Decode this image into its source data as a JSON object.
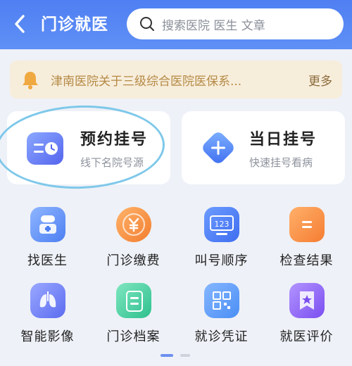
{
  "header": {
    "title": "门诊就医",
    "search_placeholder": "搜索医院 医生 文章"
  },
  "notice": {
    "text": "津南医院关于三级综合医院医保系...",
    "more": "更多"
  },
  "cards": [
    {
      "title": "预约挂号",
      "subtitle": "线下名院号源",
      "icon": "calendar-clock-icon"
    },
    {
      "title": "当日挂号",
      "subtitle": "快速挂号看病",
      "icon": "plus-diamond-icon"
    }
  ],
  "grid": [
    {
      "label": "找医生",
      "icon": "doctor-icon",
      "color": "#5b8df6"
    },
    {
      "label": "门诊缴费",
      "icon": "yuan-coin-icon",
      "color": "#f28a3c"
    },
    {
      "label": "叫号顺序",
      "icon": "queue-number-icon",
      "color": "#4d80f0"
    },
    {
      "label": "检查结果",
      "icon": "report-icon",
      "color": "#f5893c"
    },
    {
      "label": "智能影像",
      "icon": "lung-image-icon",
      "color": "#6c7cf2"
    },
    {
      "label": "门诊档案",
      "icon": "archive-icon",
      "color": "#3fcf9f"
    },
    {
      "label": "就诊凭证",
      "icon": "qr-code-icon",
      "color": "#4f9cf7"
    },
    {
      "label": "就医评价",
      "icon": "star-badge-icon",
      "color": "#8b5cf2"
    }
  ],
  "colors": {
    "header": "#5585f4",
    "notice_bg": "#f7eddb",
    "accent": "#4f7ff2"
  }
}
